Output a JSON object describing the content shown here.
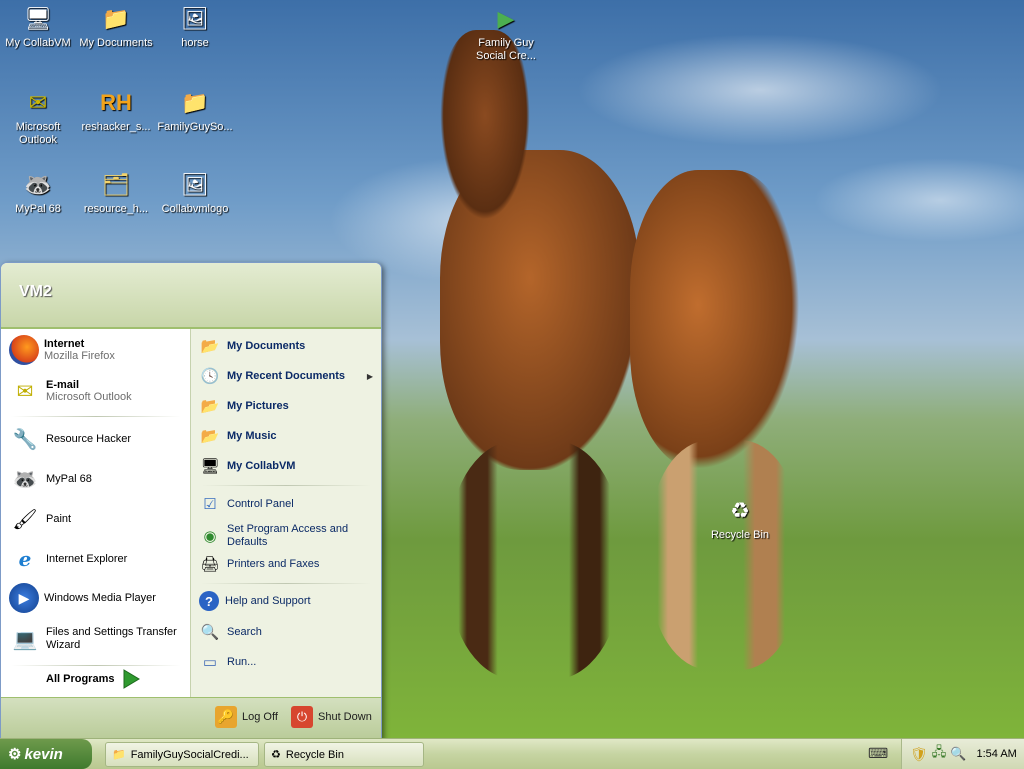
{
  "desktop": {
    "icons": [
      {
        "label": "My CollabVM",
        "icon": "computer-icon"
      },
      {
        "label": "My Documents",
        "icon": "my-documents-icon"
      },
      {
        "label": "horse",
        "icon": "image-file-icon"
      },
      {
        "label": "Family Guy Social Cre...",
        "icon": "shortcut-media-icon"
      },
      {
        "label": "Microsoft Outlook",
        "icon": "outlook-icon"
      },
      {
        "label": "reshacker_s...",
        "icon": "reshacker-icon"
      },
      {
        "label": "FamilyGuySo...",
        "icon": "folder-icon"
      },
      {
        "label": "MyPal 68",
        "icon": "mypal-icon"
      },
      {
        "label": "resource_h...",
        "icon": "zip-folder-icon"
      },
      {
        "label": "Collabvmlogo",
        "icon": "image-file-icon"
      },
      {
        "label": "Recycle Bin",
        "icon": "recycle-bin-icon"
      }
    ]
  },
  "start_menu": {
    "user": "VM2",
    "pinned": [
      {
        "title": "Internet",
        "subtitle": "Mozilla Firefox",
        "icon": "firefox-icon"
      },
      {
        "title": "E-mail",
        "subtitle": "Microsoft Outlook",
        "icon": "outlook-icon"
      }
    ],
    "recent": [
      {
        "label": "Resource Hacker",
        "icon": "resource-hacker-icon"
      },
      {
        "label": "MyPal 68",
        "icon": "mypal-icon"
      },
      {
        "label": "Paint",
        "icon": "paint-icon"
      },
      {
        "label": "Internet Explorer",
        "icon": "ie-icon"
      },
      {
        "label": "Windows Media Player",
        "icon": "media-player-icon"
      },
      {
        "label": "Files and Settings Transfer Wizard",
        "icon": "transfer-wizard-icon"
      }
    ],
    "all_programs": "All Programs",
    "places": [
      {
        "label": "My Documents",
        "icon": "my-documents-icon"
      },
      {
        "label": "My Recent Documents",
        "icon": "recent-documents-icon",
        "submenu": true
      },
      {
        "label": "My Pictures",
        "icon": "my-pictures-icon"
      },
      {
        "label": "My Music",
        "icon": "my-music-icon"
      },
      {
        "label": "My CollabVM",
        "icon": "computer-icon"
      }
    ],
    "settings": [
      {
        "label": "Control Panel",
        "icon": "control-panel-icon"
      },
      {
        "label": "Set Program Access and Defaults",
        "icon": "program-access-icon"
      },
      {
        "label": "Printers and Faxes",
        "icon": "printer-icon"
      }
    ],
    "tools": [
      {
        "label": "Help and Support",
        "icon": "help-icon"
      },
      {
        "label": "Search",
        "icon": "search-icon"
      },
      {
        "label": "Run...",
        "icon": "run-icon"
      }
    ],
    "log_off": "Log Off",
    "shut_down": "Shut Down"
  },
  "taskbar": {
    "start_label": "kevin",
    "buttons": [
      {
        "label": "FamilyGuySocialCredi...",
        "icon": "folder-icon"
      },
      {
        "label": "Recycle Bin",
        "icon": "recycle-bin-icon"
      }
    ],
    "clock": "1:54 AM"
  },
  "colors": {
    "start_accent": "#3f7a2e",
    "menu_link": "#0b2a66",
    "header": "#c8d6a9"
  }
}
